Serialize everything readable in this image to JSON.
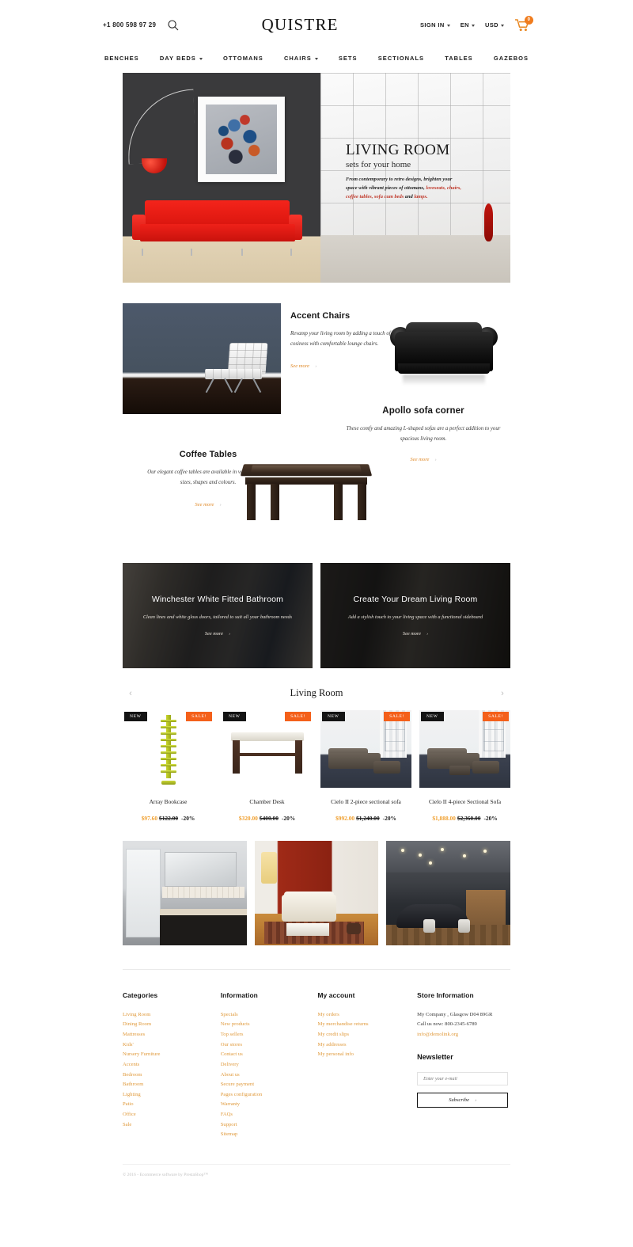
{
  "header": {
    "phone": "+1 800 598 97 29",
    "brand": "QUISTRE",
    "search_icon": "search-icon",
    "sign_in": "SIGN IN",
    "language": "EN",
    "currency": "USD",
    "cart_count": "0"
  },
  "nav": [
    {
      "label": "BENCHES",
      "has_caret": false
    },
    {
      "label": "DAY BEDS",
      "has_caret": true
    },
    {
      "label": "OTTOMANS",
      "has_caret": false
    },
    {
      "label": "CHAIRS",
      "has_caret": true
    },
    {
      "label": "SETS",
      "has_caret": false
    },
    {
      "label": "SECTIONALS",
      "has_caret": false
    },
    {
      "label": "TABLES",
      "has_caret": false
    },
    {
      "label": "GAZEBOS",
      "has_caret": false
    }
  ],
  "hero": {
    "title": "LIVING ROOM",
    "subtitle": "sets for your home",
    "desc_1": "From contemporary to retro designs, brighten your",
    "desc_2a": "space with vibrant pieces of ottomans, ",
    "desc_2b": "loveseats, chairs,",
    "desc_3a": "coffee tables, sofa cum beds",
    "desc_3b": " and ",
    "desc_3c": "lamps."
  },
  "features": {
    "accent_chairs": {
      "title": "Accent Chairs",
      "text": "Revamp your living room by adding a touch of cosiness with comfortable lounge chairs.",
      "cta": "See more"
    },
    "apollo_sofa": {
      "title": "Apollo sofa corner",
      "text": "These comfy and amazing L-shaped sofas are a perfect addition to your spacious living room.",
      "cta": "See more"
    },
    "coffee_tables": {
      "title": "Coffee Tables",
      "text": "Our elegant coffee tables are available in various styles, sizes, shapes and colours.",
      "cta": "See more"
    }
  },
  "promos": [
    {
      "title": "Winchester White Fitted Bathroom",
      "text": "Clean lines and white gloss doors, tailored to suit all your bathroom needs",
      "cta": "See more"
    },
    {
      "title": "Create Your Dream Living Room",
      "text": "Add a stylish touch to your living space with a functional sideboard",
      "cta": "See more"
    }
  ],
  "carousel": {
    "title": "Living Room",
    "prev": "‹",
    "next": "›",
    "badge_new": "NEW",
    "badge_sale": "SALE!",
    "products": [
      {
        "name": "Array Bookcase",
        "sale_price": "$97.60",
        "old_price": "$122.00",
        "discount": "-20%",
        "badges": [
          "NEW",
          "SALE!"
        ]
      },
      {
        "name": "Chamber Desk",
        "sale_price": "$320.00",
        "old_price": "$400.00",
        "discount": "-20%",
        "badges": [
          "NEW",
          "SALE!"
        ]
      },
      {
        "name": "Cielo II 2-piece sectional sofa",
        "sale_price": "$992.00",
        "old_price": "$1,240.00",
        "discount": "-20%",
        "badges": [
          "NEW",
          "SALE!"
        ]
      },
      {
        "name": "Cielo II 4-piece Sectional Sofa",
        "sale_price": "$1,888.00",
        "old_price": "$2,360.00",
        "discount": "-20%",
        "badges": [
          "NEW",
          "SALE!"
        ]
      }
    ]
  },
  "gallery": [
    {
      "name": "bathroom-interior"
    },
    {
      "name": "living-room-red-wall"
    },
    {
      "name": "dark-lounge-interior"
    }
  ],
  "footer": {
    "categories": {
      "heading": "Categories",
      "links": [
        "Living Room",
        "Dining Room",
        "Mattresses",
        "Kids'",
        "Nursery Furniture",
        "Accents",
        "Bedroom",
        "Bathroom",
        "Lighting",
        "Patio",
        "Office",
        "Sale"
      ]
    },
    "information": {
      "heading": "Information",
      "links": [
        "Specials",
        "New products",
        "Top sellers",
        "Our stores",
        "Contact us",
        "Delivery",
        "About us",
        "Secure payment",
        "Pages configuration",
        "Warranty",
        "FAQs",
        "Support",
        "Sitemap"
      ]
    },
    "my_account": {
      "heading": "My account",
      "links": [
        "My orders",
        "My merchandise returns",
        "My credit slips",
        "My addresses",
        "My personal info"
      ]
    },
    "store_information": {
      "heading": "Store Information",
      "address": "My Company , Glasgow D04 89GR",
      "phone": "Call us now: 800-2345-6789",
      "email": "info@demolink.org"
    },
    "newsletter": {
      "heading": "Newsletter",
      "placeholder": "Enter your e-mail",
      "button": "Subscribe"
    },
    "copyright": "© 2016 - Ecommerce software by PrestaShop™"
  },
  "colors": {
    "accent_orange": "#e09a3c",
    "sale_orange": "#f4601a",
    "price_gold": "#f0a132",
    "badge_black": "#141414",
    "hero_red": "#c0392b"
  }
}
